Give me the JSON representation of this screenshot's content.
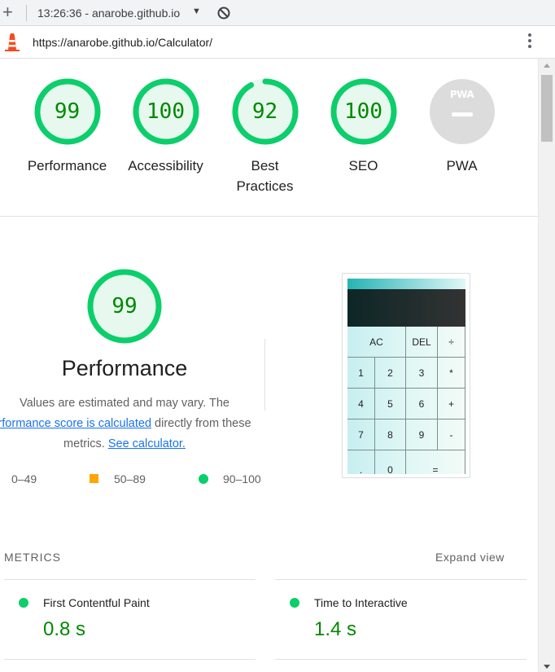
{
  "browser": {
    "tab_title": "13:26:36 - anarobe.github.io",
    "url": "https://anarobe.github.io/Calculator/",
    "new_tab_glyph": "+",
    "caret_glyph": "▼"
  },
  "gauges": [
    {
      "label": "Performance",
      "score": 99,
      "fraction": 0.99
    },
    {
      "label": "Accessibility",
      "score": 100,
      "fraction": 1.0
    },
    {
      "label": "Best Practices",
      "score": 92,
      "fraction": 0.92
    },
    {
      "label": "SEO",
      "score": 100,
      "fraction": 1.0
    },
    {
      "label": "PWA",
      "logo_text": "PWA"
    }
  ],
  "performance": {
    "score": 99,
    "fraction": 0.99,
    "title": "Performance",
    "desc_line1": "Values are estimated and may vary. The",
    "desc_link1": "rformance score is calculated",
    "desc_mid": " directly from these",
    "desc_line3_prefix": "metrics. ",
    "desc_link2": "See calculator."
  },
  "legend": {
    "fail": "0–49",
    "average": "50–89",
    "pass": "90–100"
  },
  "calculator": {
    "keys": [
      {
        "label": "AC"
      },
      {
        "label": "DEL"
      },
      {
        "label": "÷"
      },
      {
        "label": "1"
      },
      {
        "label": "2"
      },
      {
        "label": "3"
      },
      {
        "label": "*"
      },
      {
        "label": "4"
      },
      {
        "label": "5"
      },
      {
        "label": "6"
      },
      {
        "label": "+"
      },
      {
        "label": "7"
      },
      {
        "label": "8"
      },
      {
        "label": "9"
      },
      {
        "label": "-"
      },
      {
        "label": "."
      },
      {
        "label": "0"
      },
      {
        "label": "="
      }
    ]
  },
  "metrics": {
    "heading": "METRICS",
    "expand_label": "Expand view",
    "items": [
      {
        "title": "First Contentful Paint",
        "value": "0.8 s"
      },
      {
        "title": "Time to Interactive",
        "value": "1.4 s"
      }
    ]
  },
  "colors": {
    "pass": "#0cce6b",
    "pass_text": "#008800",
    "average": "#ffa400",
    "link": "#1a73e8"
  }
}
